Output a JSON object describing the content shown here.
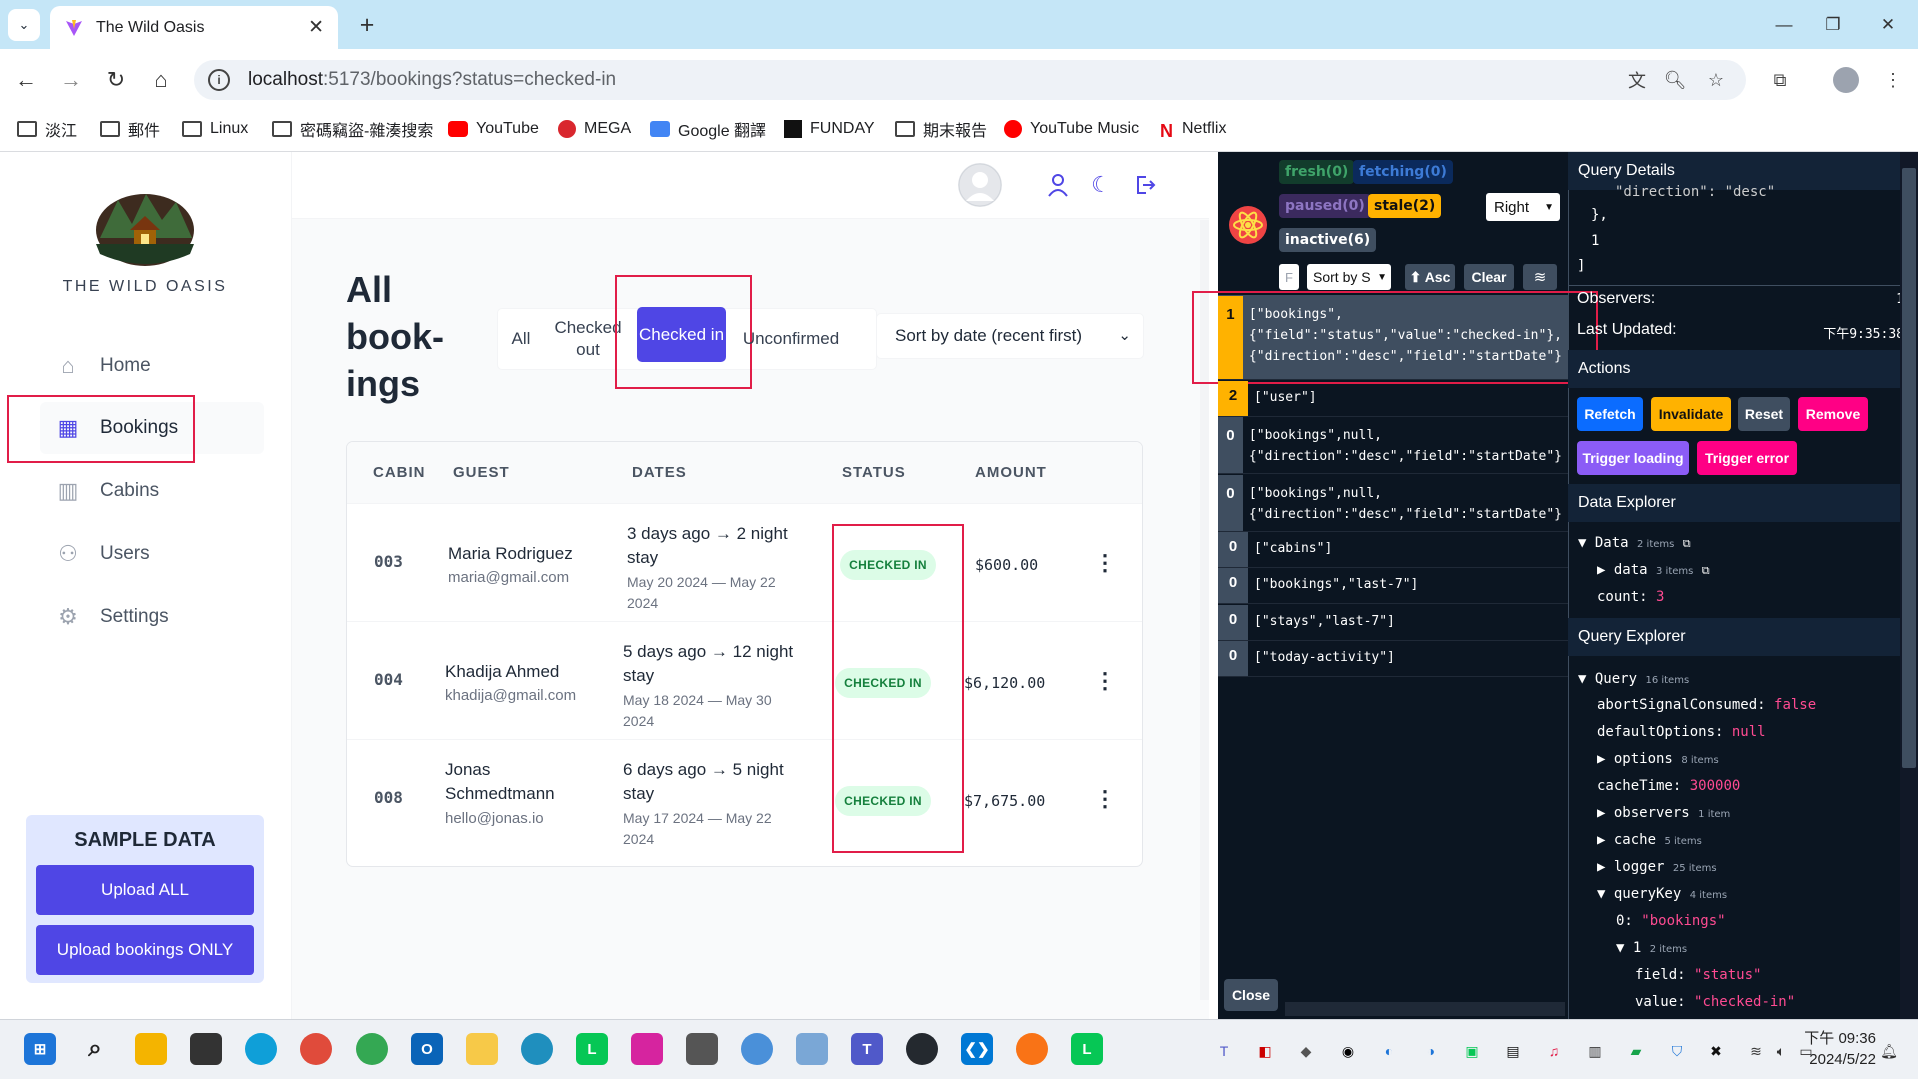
{
  "browser": {
    "tab_title": "The Wild Oasis",
    "url_host": "localhost",
    "url_rest": ":5173/bookings?status=checked-in",
    "bookmarks": [
      "淡江",
      "郵件",
      "Linux",
      "密碼竊盜-雜湊搜索",
      "YouTube",
      "MEGA",
      "Google 翻譯",
      "FUNDAY",
      "期末報告",
      "YouTube Music",
      "Netflix"
    ]
  },
  "sidebar": {
    "brand": "THE WILD OASIS",
    "items": [
      {
        "label": "Home",
        "icon": "home-icon"
      },
      {
        "label": "Bookings",
        "icon": "calendar-icon"
      },
      {
        "label": "Cabins",
        "icon": "building-icon"
      },
      {
        "label": "Users",
        "icon": "users-icon"
      },
      {
        "label": "Settings",
        "icon": "gear-icon"
      }
    ],
    "sample": {
      "title": "SAMPLE DATA",
      "upload_all": "Upload ALL",
      "upload_bookings": "Upload bookings ONLY"
    }
  },
  "main": {
    "title": "All book-ings",
    "filters": [
      "All",
      "Checked out",
      "Checked in",
      "Unconfirmed"
    ],
    "active_filter": "Checked in",
    "sort": "Sort by date (recent first)",
    "columns": [
      "CABIN",
      "GUEST",
      "DATES",
      "STATUS",
      "AMOUNT"
    ],
    "rows": [
      {
        "cabin": "003",
        "guest": "Maria Rodriguez",
        "email": "maria@gmail.com",
        "when": "3 days ago → 2 night stay",
        "range": "May 20 2024 — May 22 2024",
        "status": "CHECKED IN",
        "amount": "$600.00"
      },
      {
        "cabin": "004",
        "guest": "Khadija Ahmed",
        "email": "khadija@gmail.com",
        "when": "5 days ago → 12 night stay",
        "range": "May 18 2024 — May 30 2024",
        "status": "CHECKED IN",
        "amount": "$6,120.00"
      },
      {
        "cabin": "008",
        "guest": "Jonas Schmedtmann",
        "email": "hello@jonas.io",
        "when": "6 days ago → 5 night stay",
        "range": "May 17 2024 — May 22 2024",
        "status": "CHECKED IN",
        "amount": "$7,675.00"
      }
    ]
  },
  "devtools": {
    "pills": {
      "fresh": "fresh(0)",
      "fetching": "fetching(0)",
      "paused": "paused(0)",
      "stale": "stale(2)",
      "inactive": "inactive(6)"
    },
    "position": "Right",
    "filter_placeholder": "F",
    "sort_by": "Sort by S",
    "asc": "⬆ Asc",
    "clear": "Clear",
    "queries": [
      {
        "count": "1",
        "key": "[\"bookings\",\n{\"field\":\"status\",\"value\":\"checked-in\"},\n{\"direction\":\"desc\",\"field\":\"startDate\"}",
        "color": "#ffb200"
      },
      {
        "count": "2",
        "key": "[\"user\"]",
        "color": "#ffb200"
      },
      {
        "count": "0",
        "key": "[\"bookings\",null,\n{\"direction\":\"desc\",\"field\":\"startDate\"}",
        "color": "#3f4e60"
      },
      {
        "count": "0",
        "key": "[\"bookings\",null,\n{\"direction\":\"desc\",\"field\":\"startDate\"}",
        "color": "#3f4e60"
      },
      {
        "count": "0",
        "key": "[\"cabins\"]",
        "color": "#3f4e60"
      },
      {
        "count": "0",
        "key": "[\"bookings\",\"last-7\"]",
        "color": "#3f4e60"
      },
      {
        "count": "0",
        "key": "[\"stays\",\"last-7\"]",
        "color": "#3f4e60"
      },
      {
        "count": "0",
        "key": "[\"today-activity\"]",
        "color": "#3f4e60"
      }
    ],
    "close": "Close",
    "details": {
      "title": "Query Details",
      "code_lines": [
        "\"direction\": \"desc\"",
        "},",
        "1",
        "]"
      ],
      "observers_label": "Observers:",
      "observers_value": "1",
      "updated_label": "Last Updated:",
      "updated_value": "下午9:35:38"
    },
    "actions": {
      "title": "Actions",
      "refetch": "Refetch",
      "invalidate": "Invalidate",
      "reset": "Reset",
      "remove": "Remove",
      "trigger_loading": "Trigger loading",
      "trigger_error": "Trigger error"
    },
    "data_explorer": {
      "title": "Data Explorer",
      "data_label": "Data",
      "data_count": "2 items",
      "data_sub": "data",
      "data_sub_count": "3 items",
      "count_key": "count:",
      "count_val": "3"
    },
    "query_explorer": {
      "title": "Query Explorer",
      "query_label": "Query",
      "query_count": "16 items",
      "entries": [
        {
          "k": "abortSignalConsumed:",
          "v": "false"
        },
        {
          "k": "defaultOptions:",
          "v": "null"
        }
      ],
      "options": "options",
      "options_count": "8 items",
      "cache_time_k": "cacheTime:",
      "cache_time_v": "300000",
      "observers": "observers",
      "observers_count": "1 item",
      "cache": "cache",
      "cache_count": "5 items",
      "logger": "logger",
      "logger_count": "25 items",
      "query_key": "queryKey",
      "query_key_count": "4 items",
      "qk0_k": "0:",
      "qk0_v": "\"bookings\"",
      "qk1": "1",
      "qk1_count": "2 items",
      "field_k": "field:",
      "field_v": "\"status\"",
      "value_k": "value:",
      "value_v": "\"checked-in\""
    }
  },
  "taskbar": {
    "time": "下午 09:36",
    "date": "2024/5/22"
  }
}
